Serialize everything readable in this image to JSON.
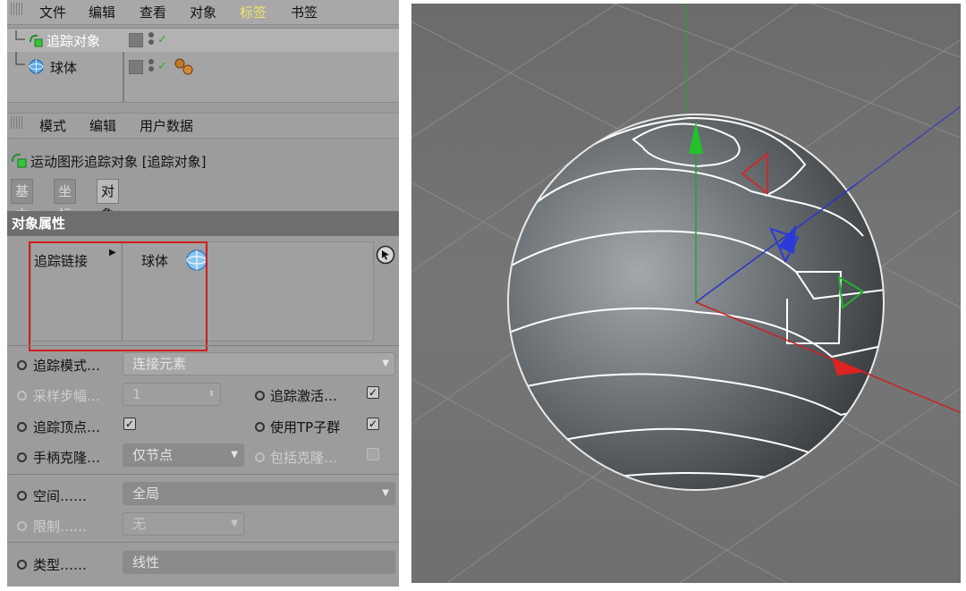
{
  "objects_menu": {
    "items": [
      "文件",
      "编辑",
      "查看",
      "对象",
      "标签",
      "书签"
    ]
  },
  "object_tree": [
    {
      "name": "追踪对象"
    },
    {
      "name": "球体"
    }
  ],
  "attributes_menu": {
    "items": [
      "模式",
      "编辑",
      "用户数据"
    ]
  },
  "object_header": "运动图形追踪对象 [追踪对象]",
  "tabs": [
    "基本",
    "坐标",
    "对象"
  ],
  "section_title": "对象属性",
  "fields": {
    "trace_link": {
      "label": "追踪链接",
      "value": "球体"
    },
    "trace_mode": {
      "label": "追踪模式…",
      "value": "连接元素"
    },
    "sample_step": {
      "label": "采样步幅…",
      "value": "1"
    },
    "trace_active": {
      "label": "追踪激活…",
      "checked": true
    },
    "trace_vertices": {
      "label": "追踪顶点…",
      "checked": true
    },
    "use_tp_subgroup": {
      "label": "使用TP子群",
      "checked": true
    },
    "handle_clone": {
      "label": "手柄克隆…",
      "value": "仅节点"
    },
    "include_clones": {
      "label": "包括克隆…",
      "checked": false
    },
    "space": {
      "label": "空间……",
      "value": "全局"
    },
    "limit": {
      "label": "限制……",
      "value": "无"
    },
    "type": {
      "label": "类型……",
      "value": "线性"
    }
  },
  "colors": {
    "accent_red": "#d21c1c",
    "tag_yellow": "#f1e36a"
  }
}
